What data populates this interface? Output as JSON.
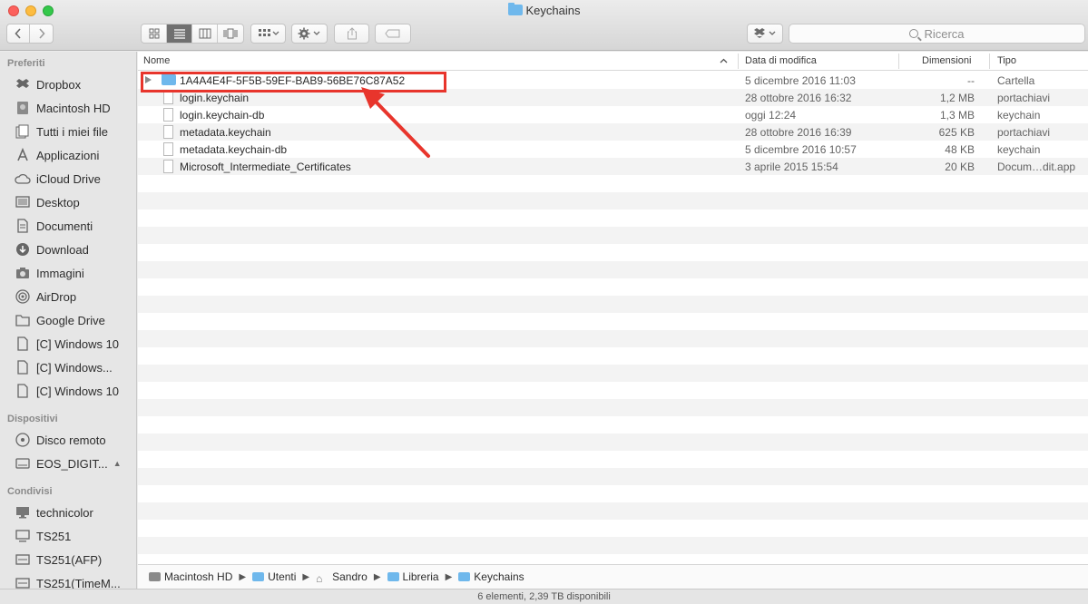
{
  "window": {
    "title": "Keychains"
  },
  "toolbar": {
    "back_icon": "chevron-left-icon",
    "forward_icon": "chevron-right-icon",
    "view_modes": [
      "icon-view-icon",
      "list-view-icon",
      "column-view-icon",
      "cover-flow-icon"
    ],
    "active_view": "list-view-icon",
    "arrange_icon": "arrange-icon",
    "action_icon": "gear-icon",
    "share_icon": "share-icon",
    "tag_icon": "tag-icon",
    "dropbox_icon": "dropbox-icon",
    "search_placeholder": "Ricerca"
  },
  "sidebar": {
    "sections": [
      {
        "title": "Preferiti",
        "items": [
          {
            "label": "Dropbox",
            "icon": "dropbox-icon"
          },
          {
            "label": "Macintosh HD",
            "icon": "hard-drive-icon"
          },
          {
            "label": "Tutti i miei file",
            "icon": "all-files-icon"
          },
          {
            "label": "Applicazioni",
            "icon": "applications-icon"
          },
          {
            "label": "iCloud Drive",
            "icon": "cloud-icon"
          },
          {
            "label": "Desktop",
            "icon": "desktop-icon"
          },
          {
            "label": "Documenti",
            "icon": "documents-icon"
          },
          {
            "label": "Download",
            "icon": "download-icon"
          },
          {
            "label": "Immagini",
            "icon": "camera-icon"
          },
          {
            "label": "AirDrop",
            "icon": "airdrop-icon"
          },
          {
            "label": "Google Drive",
            "icon": "folder-icon"
          },
          {
            "label": "[C] Windows 10",
            "icon": "document-icon"
          },
          {
            "label": "[C] Windows...",
            "icon": "document-icon"
          },
          {
            "label": "[C] Windows 10",
            "icon": "document-icon"
          }
        ]
      },
      {
        "title": "Dispositivi",
        "items": [
          {
            "label": "Disco remoto",
            "icon": "disc-icon"
          },
          {
            "label": "EOS_DIGIT...",
            "icon": "external-drive-icon",
            "eject": true
          }
        ]
      },
      {
        "title": "Condivisi",
        "items": [
          {
            "label": "technicolor",
            "icon": "monitor-icon"
          },
          {
            "label": "TS251",
            "icon": "monitor-icon"
          },
          {
            "label": "TS251(AFP)",
            "icon": "nas-icon"
          },
          {
            "label": "TS251(TimeM...",
            "icon": "nas-icon"
          }
        ]
      }
    ]
  },
  "list": {
    "columns": {
      "name": "Nome",
      "date": "Data di modifica",
      "size": "Dimensioni",
      "kind": "Tipo"
    },
    "sort_indicator": "chevron-up-icon",
    "rows": [
      {
        "name": "1A4A4E4F-5F5B-59EF-BAB9-56BE76C87A52",
        "date": "5 dicembre 2016 11:03",
        "size": "--",
        "kind": "Cartella",
        "type": "folder"
      },
      {
        "name": "login.keychain",
        "date": "28 ottobre 2016 16:32",
        "size": "1,2 MB",
        "kind": "portachiavi",
        "type": "file"
      },
      {
        "name": "login.keychain-db",
        "date": "oggi 12:24",
        "size": "1,3 MB",
        "kind": "keychain",
        "type": "file"
      },
      {
        "name": "metadata.keychain",
        "date": "28 ottobre 2016 16:39",
        "size": "625 KB",
        "kind": "portachiavi",
        "type": "file"
      },
      {
        "name": "metadata.keychain-db",
        "date": "5 dicembre 2016 10:57",
        "size": "48 KB",
        "kind": "keychain",
        "type": "file"
      },
      {
        "name": "Microsoft_Intermediate_Certificates",
        "date": "3 aprile 2015 15:54",
        "size": "20 KB",
        "kind": "Docum…dit.app",
        "type": "file"
      }
    ]
  },
  "pathbar": {
    "crumbs": [
      {
        "label": "Macintosh HD",
        "icon": "hard-drive-icon"
      },
      {
        "label": "Utenti",
        "icon": "folder-icon"
      },
      {
        "label": "Sandro",
        "icon": "home-icon"
      },
      {
        "label": "Libreria",
        "icon": "folder-icon"
      },
      {
        "label": "Keychains",
        "icon": "folder-icon"
      }
    ]
  },
  "status": {
    "text": "6 elementi, 2,39 TB disponibili"
  },
  "annotation": {
    "color": "#e8352c"
  }
}
